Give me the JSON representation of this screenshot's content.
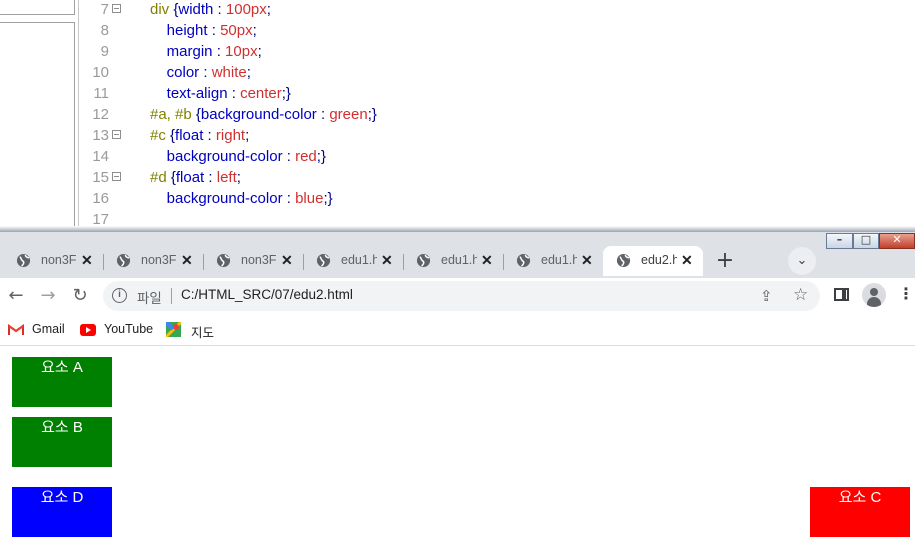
{
  "editor": {
    "lines": [
      {
        "num": "7",
        "fold": true,
        "tokens": [
          {
            "t": "div ",
            "c": "sel"
          },
          {
            "t": "{",
            "c": "brace"
          },
          {
            "t": "width",
            "c": "prop"
          },
          {
            "t": " : ",
            "c": "punc"
          },
          {
            "t": "100px",
            "c": "val"
          },
          {
            "t": ";",
            "c": "punc"
          }
        ]
      },
      {
        "num": "8",
        "fold": false,
        "tokens": [
          {
            "t": "    height",
            "c": "prop"
          },
          {
            "t": " : ",
            "c": "punc"
          },
          {
            "t": "50px",
            "c": "val"
          },
          {
            "t": ";",
            "c": "punc"
          }
        ]
      },
      {
        "num": "9",
        "fold": false,
        "tokens": [
          {
            "t": "    margin",
            "c": "prop"
          },
          {
            "t": " : ",
            "c": "punc"
          },
          {
            "t": "10px",
            "c": "val"
          },
          {
            "t": ";",
            "c": "punc"
          }
        ]
      },
      {
        "num": "10",
        "fold": false,
        "tokens": [
          {
            "t": "    color",
            "c": "prop"
          },
          {
            "t": " : ",
            "c": "punc"
          },
          {
            "t": "white",
            "c": "val"
          },
          {
            "t": ";",
            "c": "punc"
          }
        ]
      },
      {
        "num": "11",
        "fold": false,
        "tokens": [
          {
            "t": "    text-align",
            "c": "prop"
          },
          {
            "t": " : ",
            "c": "punc"
          },
          {
            "t": "center",
            "c": "val"
          },
          {
            "t": ";}",
            "c": "punc"
          }
        ]
      },
      {
        "num": "12",
        "fold": false,
        "tokens": [
          {
            "t": "#a, #b ",
            "c": "sel"
          },
          {
            "t": "{",
            "c": "brace"
          },
          {
            "t": "background-color",
            "c": "prop"
          },
          {
            "t": " : ",
            "c": "punc"
          },
          {
            "t": "green",
            "c": "val"
          },
          {
            "t": ";}",
            "c": "punc"
          }
        ]
      },
      {
        "num": "13",
        "fold": true,
        "tokens": [
          {
            "t": "#c ",
            "c": "sel"
          },
          {
            "t": "{",
            "c": "brace"
          },
          {
            "t": "float",
            "c": "prop"
          },
          {
            "t": " : ",
            "c": "punc"
          },
          {
            "t": "right",
            "c": "val"
          },
          {
            "t": ";",
            "c": "punc"
          }
        ]
      },
      {
        "num": "14",
        "fold": false,
        "tokens": [
          {
            "t": "    background-color",
            "c": "prop"
          },
          {
            "t": " : ",
            "c": "punc"
          },
          {
            "t": "red",
            "c": "val"
          },
          {
            "t": ";}",
            "c": "punc"
          }
        ]
      },
      {
        "num": "15",
        "fold": true,
        "tokens": [
          {
            "t": "#d ",
            "c": "sel"
          },
          {
            "t": "{",
            "c": "brace"
          },
          {
            "t": "float",
            "c": "prop"
          },
          {
            "t": " : ",
            "c": "punc"
          },
          {
            "t": "left",
            "c": "val"
          },
          {
            "t": ";",
            "c": "punc"
          }
        ]
      },
      {
        "num": "16",
        "fold": false,
        "tokens": [
          {
            "t": "    background-color",
            "c": "prop"
          },
          {
            "t": " : ",
            "c": "punc"
          },
          {
            "t": "blue",
            "c": "val"
          },
          {
            "t": ";}",
            "c": "punc"
          }
        ]
      },
      {
        "num": "17",
        "fold": false,
        "tokens": []
      }
    ]
  },
  "browser": {
    "tabs": [
      {
        "label": "non3Fl",
        "active": false,
        "icon": "globe-icon"
      },
      {
        "label": "non3Fl",
        "active": false,
        "icon": "globe-icon"
      },
      {
        "label": "non3Fl",
        "active": false,
        "icon": "globe-icon"
      },
      {
        "label": "edu1.h",
        "active": false,
        "icon": "globe-icon"
      },
      {
        "label": "edu1.h",
        "active": false,
        "icon": "globe-icon"
      },
      {
        "label": "edu1.h",
        "active": false,
        "icon": "globe-icon"
      },
      {
        "label": "edu2.h",
        "active": true,
        "icon": "globe-icon"
      }
    ],
    "tab_close_glyph": "✕",
    "new_tab_glyph": "+",
    "tab_search_glyph": "⌄",
    "window_buttons": {
      "minimize": "–",
      "maximize": "□",
      "close": "✕"
    },
    "nav": {
      "back": "←",
      "forward": "→",
      "reload": "↻"
    },
    "address": {
      "info_glyph": "i",
      "scheme_label": "파일",
      "url": "C:/HTML_SRC/07/edu2.html"
    },
    "toolbar_icons": {
      "share": "⇪",
      "star": "☆",
      "menu": "⋮"
    },
    "bookmarks": [
      {
        "label": "Gmail",
        "icon": "gmail-icon"
      },
      {
        "label": "YouTube",
        "icon": "youtube-icon"
      },
      {
        "label": "지도",
        "icon": "maps-icon"
      }
    ]
  },
  "page": {
    "boxes": [
      {
        "id": "a",
        "label": "요소 A",
        "color": "#008000"
      },
      {
        "id": "b",
        "label": "요소 B",
        "color": "#008000"
      },
      {
        "id": "d",
        "label": "요소 D",
        "color": "#0000ff"
      },
      {
        "id": "c",
        "label": "요소 C",
        "color": "#ff0000"
      }
    ]
  },
  "colors": {
    "tabstrip": "#dee1e6",
    "omnibox": "#f1f3f4",
    "green": "#008000",
    "red": "#ff0000",
    "blue": "#0000ff"
  }
}
